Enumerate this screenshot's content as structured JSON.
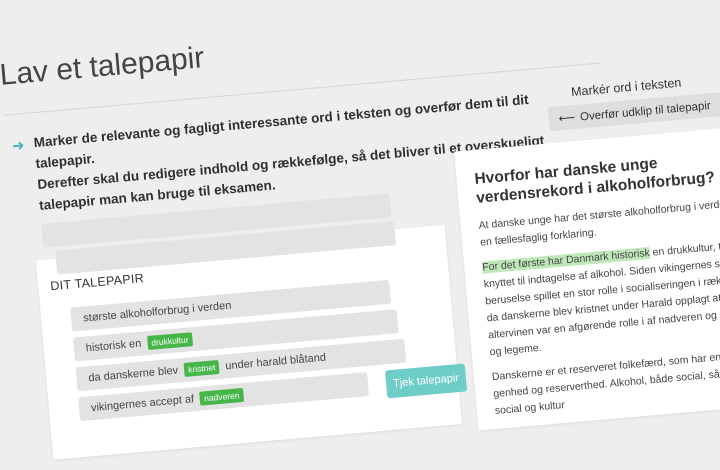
{
  "page": {
    "title": "Lav et talepapir"
  },
  "instructions": {
    "line1": "Marker de relevante og fagligt interessante ord i teksten og overfør dem til dit talepapir.",
    "line2": "Derefter skal du redigere indhold og rækkefølge, så det bliver til et overskueligt talepapir man kan bruge til eksamen."
  },
  "toolbar": {
    "mark_label": "Markér ord i teksten",
    "transfer_label": "Overfør udklip til talepapir",
    "transfer_icon": "arrow-left-icon"
  },
  "talepapir": {
    "title": "DIT TALEPAPIR",
    "items": [
      {
        "before": "største alkoholforbrug i verden",
        "tag": "",
        "after": ""
      },
      {
        "before": "historisk en",
        "tag": "drukkultur",
        "after": ""
      },
      {
        "before": "da danskerne blev",
        "tag": "kristnet",
        "after": "under harald blåtand"
      },
      {
        "before": "vikingernes accept af",
        "tag": "nadveren",
        "after": ""
      }
    ],
    "check_button": "Tjek talepapir",
    "tag_color": "#47b649",
    "check_color": "#6fcdc8"
  },
  "article": {
    "title": "Hvorfor har danske unge verdensrekord i alkoholforbrug?",
    "p1": "At danske unge har det største alkoholforbrug i verden, har en fællesfaglig forklaring.",
    "p2_highlight": "For det første har Danmark historisk",
    "p2_rest": " en drukkultur, tæt knyttet til indtagelse af alkohol. Siden vikingernes sanseløs beruselse spillet en stor rolle i socialiseringen i rækker. Og da danskerne blev kristnet under Harald opplagt at tænke, at altervinen var en afgørende rolle i af nadveren og jesu blod og legeme.",
    "p3": "Danskerne er et reserveret folkefærd, som har en skrøbelig genhed og reserverthed. Alkohol, både social, såvel som social og kultur",
    "highlight_color": "#bfe8b8"
  }
}
